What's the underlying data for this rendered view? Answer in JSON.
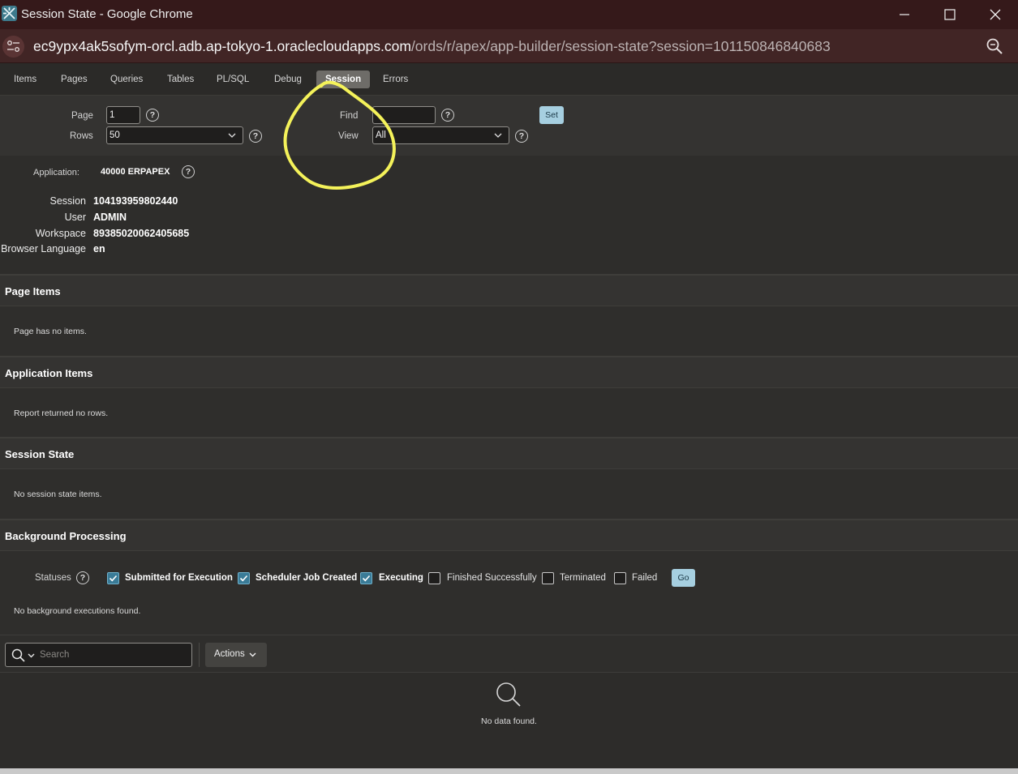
{
  "window": {
    "title": "Session State - Google Chrome"
  },
  "address": {
    "host": "ec9ypx4ak5sofym-orcl.adb.ap-tokyo-1.oraclecloudapps.com",
    "path": "/ords/r/apex/app-builder/session-state?session=101150846840683"
  },
  "tabs": [
    {
      "label": "Items"
    },
    {
      "label": "Pages"
    },
    {
      "label": "Queries"
    },
    {
      "label": "Tables"
    },
    {
      "label": "PL/SQL"
    },
    {
      "label": "Debug"
    },
    {
      "label": "Session"
    },
    {
      "label": "Errors"
    }
  ],
  "form": {
    "page_label": "Page",
    "page_value": "1",
    "rows_label": "Rows",
    "rows_value": "50",
    "find_label": "Find",
    "find_value": "",
    "view_label": "View",
    "view_value": "All",
    "set_label": "Set"
  },
  "info": {
    "application_label": "Application:",
    "application_value": "40000 ERPAPEX",
    "session_label": "Session",
    "session_value": "104193959802440",
    "user_label": "User",
    "user_value": "ADMIN",
    "workspace_label": "Workspace",
    "workspace_value": "89385020062405685",
    "language_label": "Browser Language",
    "language_value": "en"
  },
  "sections": {
    "page_items": {
      "title": "Page Items",
      "message": "Page has no items."
    },
    "application_items": {
      "title": "Application Items",
      "message": "Report returned no rows."
    },
    "session_state": {
      "title": "Session State",
      "message": "No session state items."
    },
    "background": {
      "title": "Background Processing",
      "statuses_label": "Statuses",
      "statuses": [
        {
          "label": "Submitted for Execution",
          "checked": true
        },
        {
          "label": "Scheduler Job Created",
          "checked": true
        },
        {
          "label": "Executing",
          "checked": true
        },
        {
          "label": "Finished Successfully",
          "checked": false
        },
        {
          "label": "Terminated",
          "checked": false
        },
        {
          "label": "Failed",
          "checked": false
        }
      ],
      "go_label": "Go",
      "message": "No background executions found."
    }
  },
  "report": {
    "search_placeholder": "Search",
    "actions_label": "Actions",
    "no_data": "No data found."
  },
  "colors": {
    "titlebar": "#35191a",
    "accent": "#a6cfe0",
    "checkbox_checked": "#3a7b97",
    "annotation": "#f4f25a"
  }
}
